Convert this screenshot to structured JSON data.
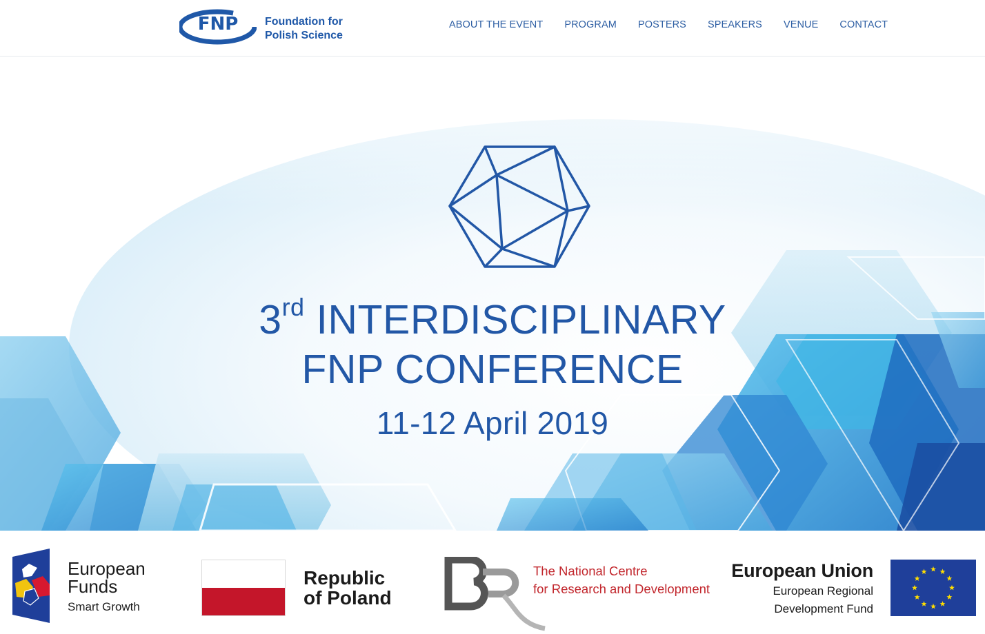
{
  "header": {
    "logo_abbr": "FNP",
    "logo_name_line1": "Foundation for",
    "logo_name_line2": "Polish Science",
    "nav": [
      {
        "label": "ABOUT THE EVENT"
      },
      {
        "label": "PROGRAM"
      },
      {
        "label": "POSTERS"
      },
      {
        "label": "SPEAKERS"
      },
      {
        "label": "VENUE"
      },
      {
        "label": "CONTACT"
      }
    ]
  },
  "hero": {
    "edition_number": "3",
    "edition_suffix": "rd",
    "title_line1_rest": "INTERDISCIPLINARY",
    "title_line2": "FNP CONFERENCE",
    "date": "11-12 April 2019",
    "emblem_icon": "icosahedron-icon"
  },
  "funding": {
    "european_funds": {
      "line1": "European",
      "line2": "Funds",
      "sub": "Smart Growth"
    },
    "poland": {
      "line1": "Republic",
      "line2": "of Poland"
    },
    "ncbr": {
      "line1": "The National Centre",
      "line2": "for Research and Development"
    },
    "eu": {
      "title": "European Union",
      "sub_line1": "European Regional",
      "sub_line2": "Development Fund"
    }
  },
  "colors": {
    "brand_blue": "#2257a6",
    "nav_blue": "#2d5ea3",
    "poland_red": "#c4162a",
    "ncbr_red": "#c2272d",
    "eu_blue": "#1f3f9a",
    "eu_star": "#ffdd00"
  }
}
